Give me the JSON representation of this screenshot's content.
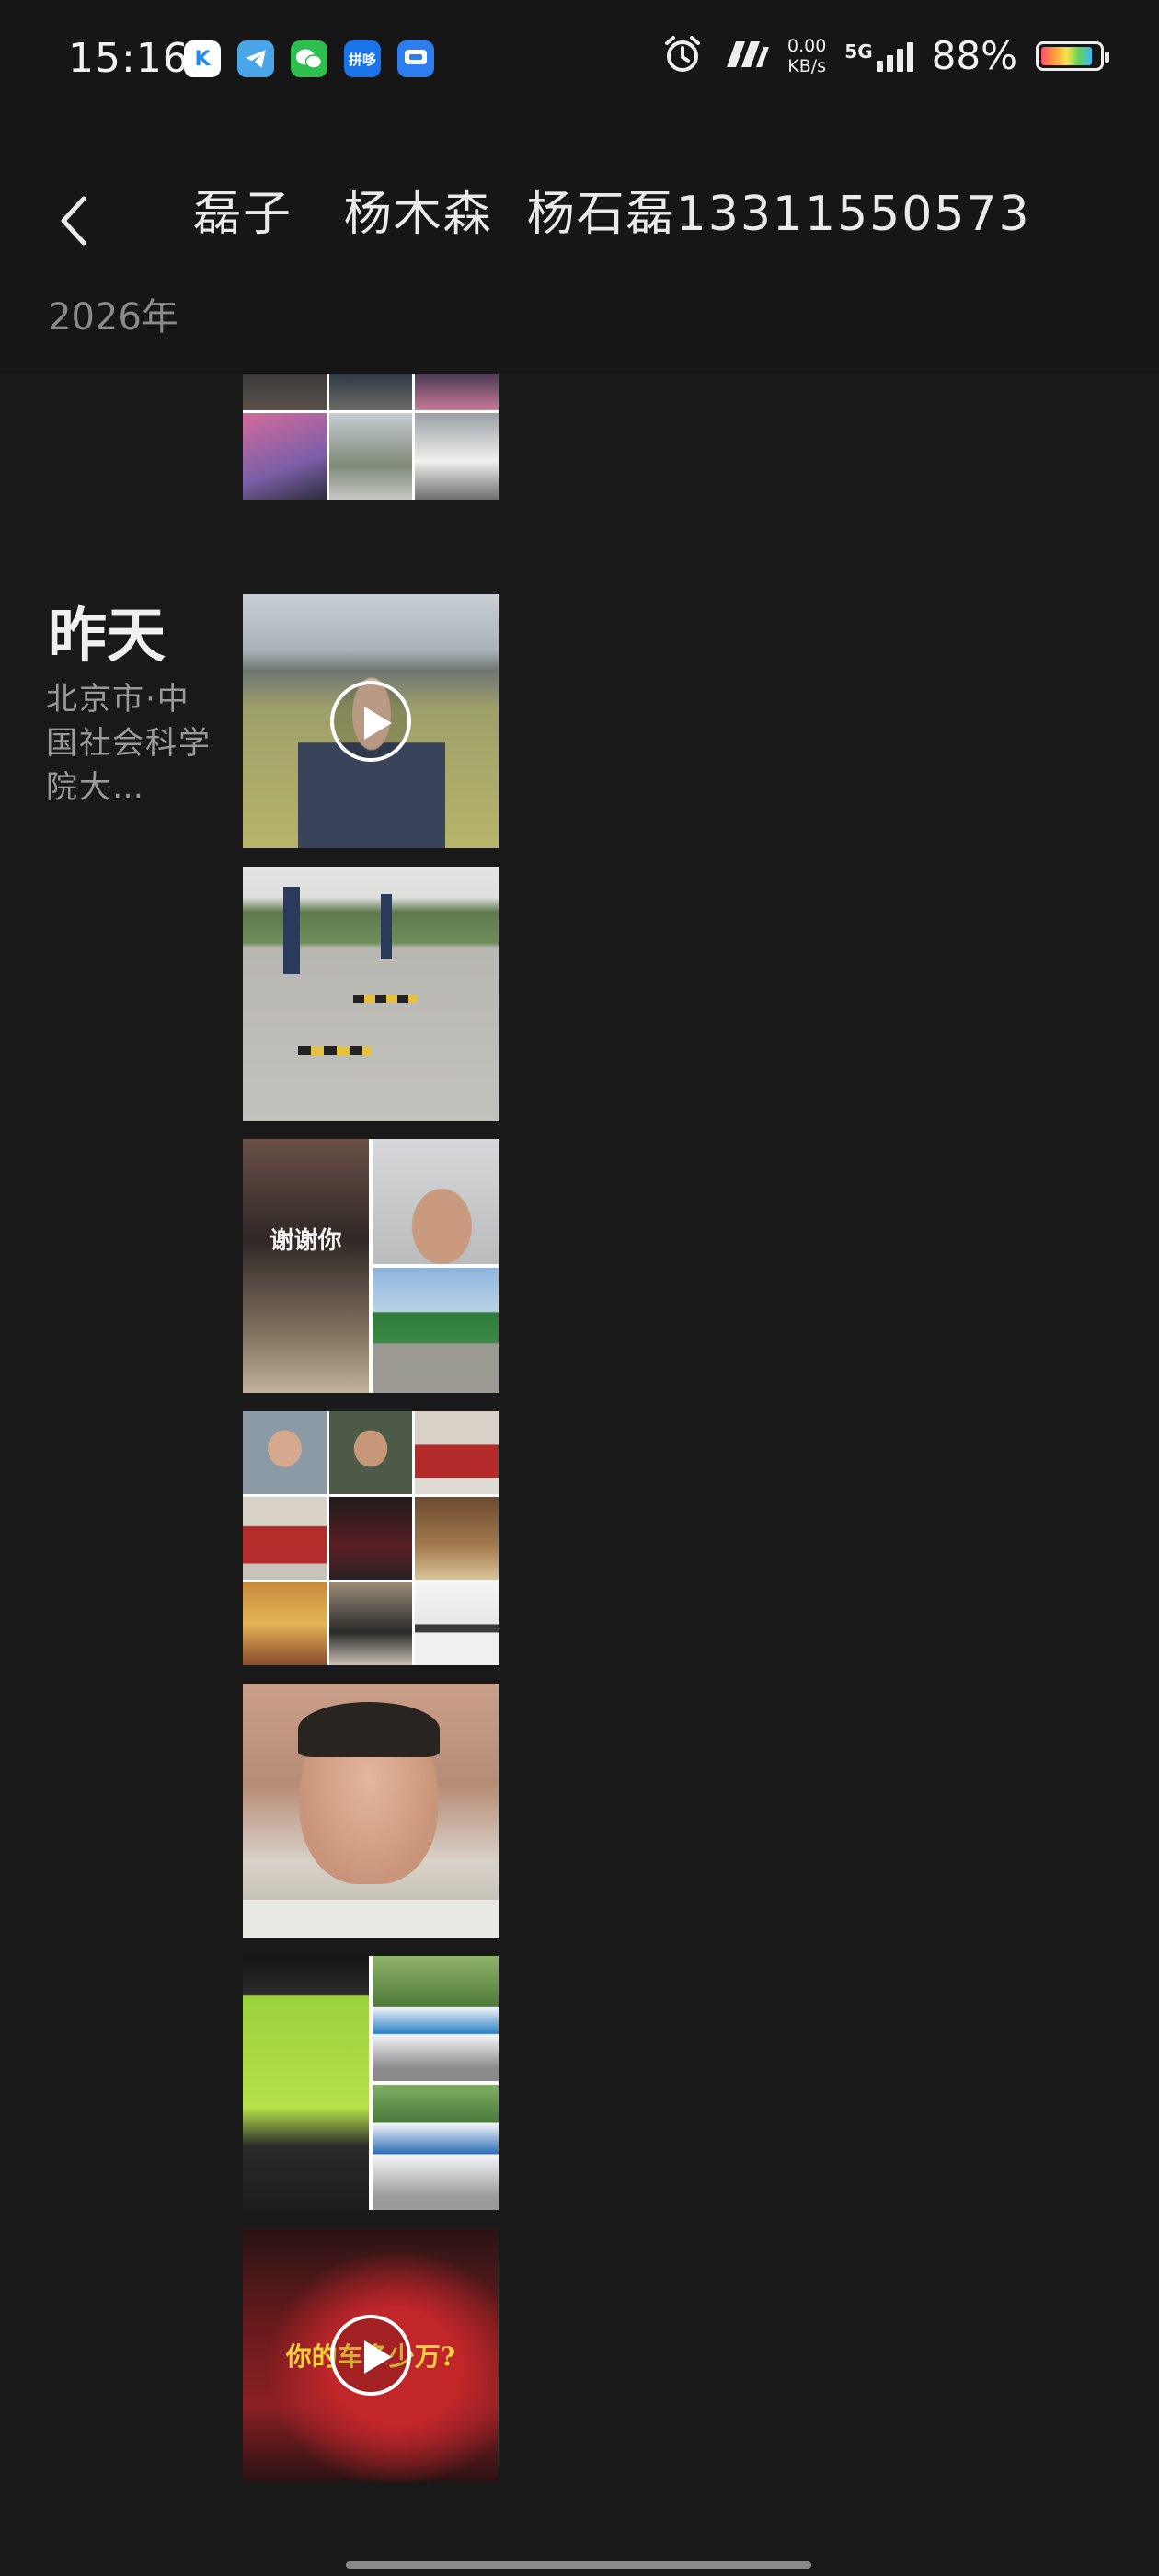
{
  "status_bar": {
    "time": "15:16",
    "network_speed_value": "0.00",
    "network_speed_unit": "KB/s",
    "signal_type": "5G",
    "battery_percent": "88%",
    "battery_level": 0.88,
    "app_icons": [
      "k-app-icon",
      "telegram-icon",
      "wechat-icon",
      "pinduoduo-icon",
      "message-icon"
    ],
    "pdd_label": "拼哆"
  },
  "header": {
    "title": "磊子   杨木森  杨石磊13311550573",
    "year": "2026年"
  },
  "day_group": {
    "label": "昨天",
    "location": "北京市·中国社会科学院大…"
  },
  "tiles": {
    "thank_you_text": "谢谢你",
    "car_text": "你的车多少万?"
  }
}
